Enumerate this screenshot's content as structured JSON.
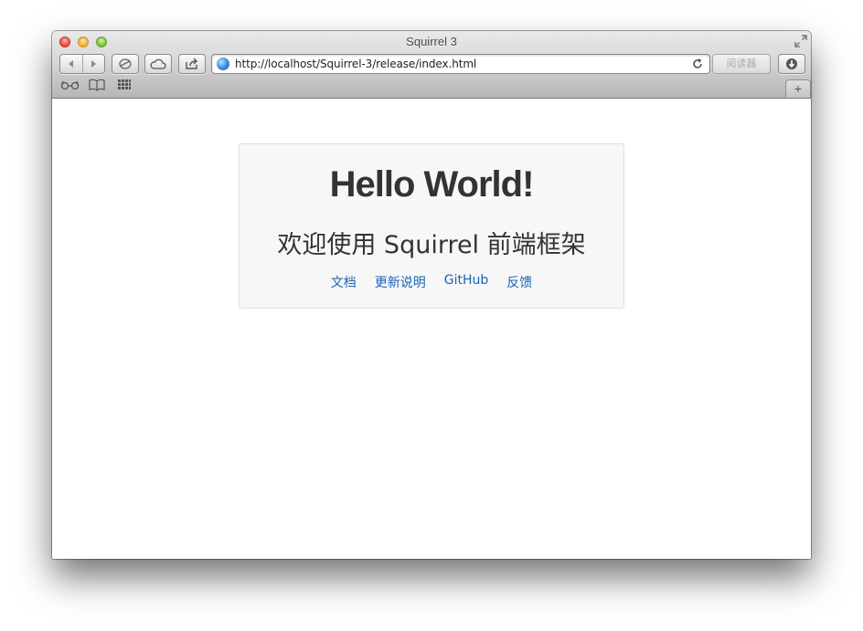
{
  "window": {
    "title": "Squirrel 3"
  },
  "toolbar": {
    "back_icon": "back-arrow-icon",
    "forward_icon": "forward-arrow-icon",
    "history_icon": "history-icon",
    "icloud_icon": "cloud-icon",
    "share_icon": "share-icon",
    "downloads_icon": "downloads-icon",
    "reader_label": "阅读器"
  },
  "address_bar": {
    "url": "http://localhost/Squirrel-3/release/index.html"
  },
  "bookmarks_bar": {
    "reading_list_icon": "glasses-icon",
    "bookmarks_icon": "book-icon",
    "top_sites_icon": "grid-icon",
    "new_tab_label": "+"
  },
  "page": {
    "heading": "Hello World!",
    "lead": "欢迎使用 Squirrel 前端框架",
    "links": [
      {
        "label": "文档"
      },
      {
        "label": "更新说明"
      },
      {
        "label": "GitHub"
      },
      {
        "label": "反馈"
      }
    ]
  },
  "colors": {
    "link": "#1a63b8",
    "hero_bg": "#f7f7f7",
    "text": "#333333"
  }
}
